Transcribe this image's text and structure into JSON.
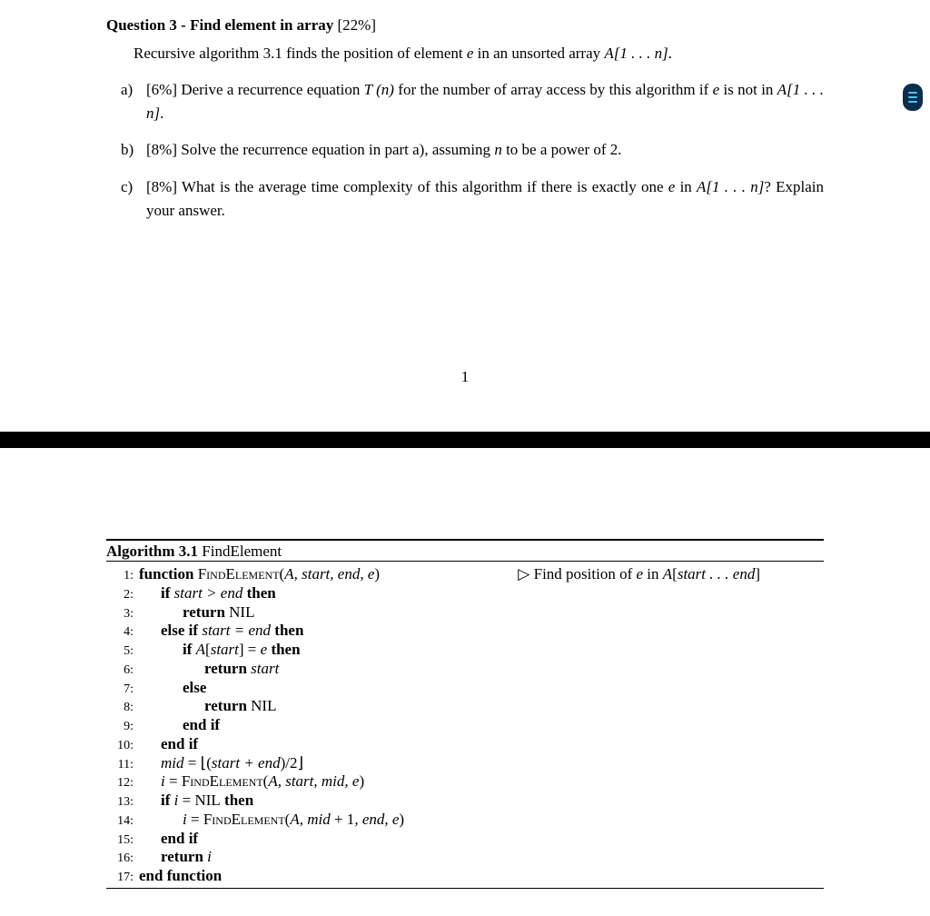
{
  "question": {
    "heading_bold": "Question 3 - Find element in array",
    "heading_pct": " [22%]",
    "intro_a": "Recursive algorithm 3.1 finds the position of element ",
    "intro_b": " in an unsorted array ",
    "parts": {
      "a": {
        "letter": "a)",
        "pct": "[6%] ",
        "t1": "Derive a recurrence equation ",
        "t2": " for the number of array access by this algorithm if ",
        "t3": " is not in "
      },
      "b": {
        "letter": "b)",
        "pct": "[8%] ",
        "t1": "Solve the recurrence equation in part a), assuming ",
        "t2": " to be a power of 2."
      },
      "c": {
        "letter": "c)",
        "pct": "[8%] ",
        "t1": "What is the average time complexity of this algorithm if there is exactly one ",
        "t2": " in ",
        "t3": "? Explain your answer."
      }
    }
  },
  "math": {
    "e": "e",
    "A1n": "A[1 . . . n]",
    "Tn": "T (n)",
    "n": "n",
    "Ase": "A[start . . . end]",
    "period": "."
  },
  "pagenum": "1",
  "algorithm": {
    "title_bold": "Algorithm 3.1",
    "title_name": " FindElement",
    "lines": [
      {
        "n": "1:",
        "indent": 0,
        "html": "<span class='b'>function </span><span class='sc'>FindElement</span>(<span class='it'>A, start, end, e</span>)",
        "comment": "▷ Find position of <span class='it'>e</span> in <span class='it'>A</span>[<span class='it'>start . . . end</span>]"
      },
      {
        "n": "2:",
        "indent": 1,
        "html": "<span class='b'>if </span><span class='it'>start &gt; end</span><span class='b'> then</span>"
      },
      {
        "n": "3:",
        "indent": 2,
        "html": "<span class='b'>return </span>NIL"
      },
      {
        "n": "4:",
        "indent": 1,
        "html": "<span class='b'>else if </span><span class='it'>start = end</span><span class='b'> then</span>"
      },
      {
        "n": "5:",
        "indent": 2,
        "html": "<span class='b'>if </span><span class='it'>A</span>[<span class='it'>start</span>] = <span class='it'>e</span><span class='b'> then</span>"
      },
      {
        "n": "6:",
        "indent": 3,
        "html": "<span class='b'>return </span><span class='it'>start</span>"
      },
      {
        "n": "7:",
        "indent": 2,
        "html": "<span class='b'>else</span>"
      },
      {
        "n": "8:",
        "indent": 3,
        "html": "<span class='b'>return </span>NIL"
      },
      {
        "n": "9:",
        "indent": 2,
        "html": "<span class='b'>end if</span>"
      },
      {
        "n": "10:",
        "indent": 1,
        "html": "<span class='b'>end if</span>"
      },
      {
        "n": "11:",
        "indent": 1,
        "html": "<span class='it'>mid</span> = ⌊(<span class='it'>start + end</span>)/2⌋"
      },
      {
        "n": "12:",
        "indent": 1,
        "html": "<span class='it'>i</span> = <span class='sc'>FindElement</span>(<span class='it'>A, start, mid, e</span>)"
      },
      {
        "n": "13:",
        "indent": 1,
        "html": "<span class='b'>if </span><span class='it'>i</span> = NIL<span class='b'> then</span>"
      },
      {
        "n": "14:",
        "indent": 2,
        "html": "<span class='it'>i</span> = <span class='sc'>FindElement</span>(<span class='it'>A, mid</span> + 1<span class='it'>, end, e</span>)"
      },
      {
        "n": "15:",
        "indent": 1,
        "html": "<span class='b'>end if</span>"
      },
      {
        "n": "16:",
        "indent": 1,
        "html": "<span class='b'>return </span><span class='it'>i</span>"
      },
      {
        "n": "17:",
        "indent": 0,
        "html": "<span class='b'>end function</span>"
      }
    ]
  }
}
